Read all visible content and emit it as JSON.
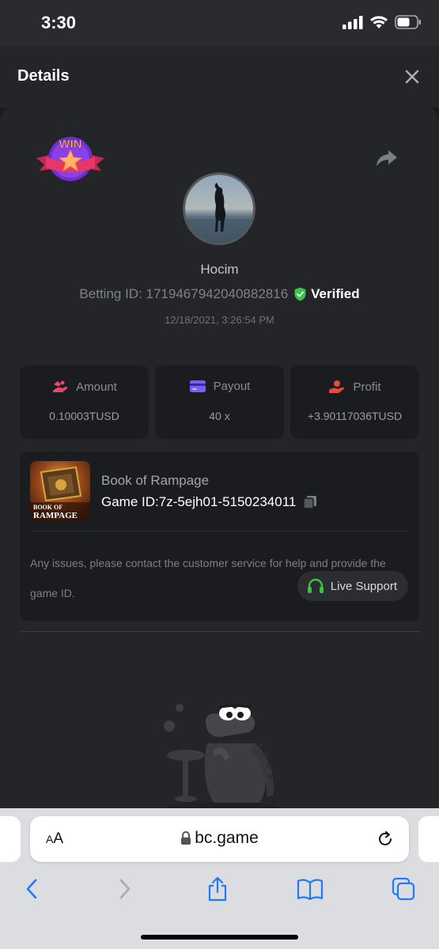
{
  "status_bar": {
    "time": "3:30"
  },
  "header": {
    "title": "Details"
  },
  "user": {
    "name": "Hocim",
    "betting_id": "Betting ID: 1719467942040882816",
    "verified_label": "Verified",
    "timestamp": "12/18/2021, 3:26:54 PM"
  },
  "badge": {
    "text": "WIN"
  },
  "stats": [
    {
      "label": "Amount",
      "value": "0.10003TUSD",
      "icon": "amount-icon",
      "color": "#e8476e"
    },
    {
      "label": "Payout",
      "value": "40 x",
      "icon": "card-icon",
      "color": "#7b5cff"
    },
    {
      "label": "Profit",
      "value": "+3.90117036TUSD",
      "icon": "profit-hand-icon",
      "color": "#e84a3c"
    }
  ],
  "game": {
    "name": "Book of Rampage",
    "game_id": "Game ID:7z-5ejh01-5150234011",
    "thumb_text_1": "BOOK OF",
    "thumb_text_2": "RAMPAGE",
    "issue_text": "Any issues, please contact the customer service for help and provide the game ID.",
    "support_label": "Live Support"
  },
  "browser": {
    "aa_label_small": "A",
    "aa_label_large": "A",
    "url": "bc.game"
  },
  "colors": {
    "verified_green": "#3bc04a",
    "support_green": "#3bc04a",
    "ios_blue": "#1f7cf6"
  }
}
